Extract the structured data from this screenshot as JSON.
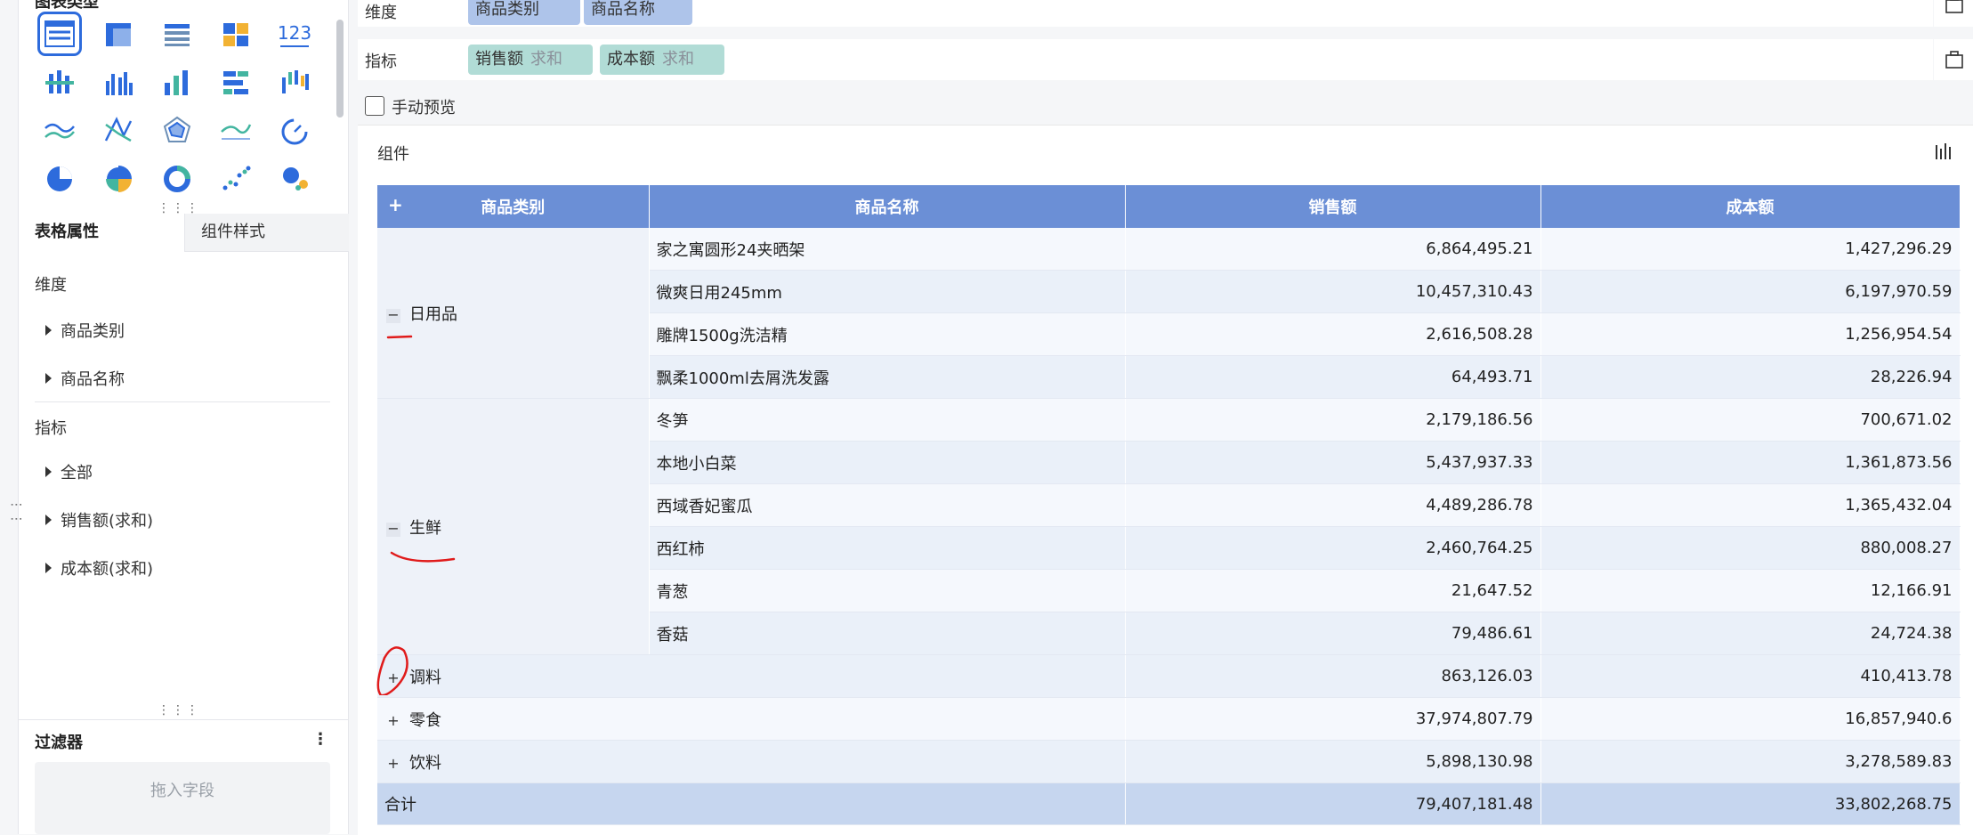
{
  "left_panel": {
    "chart_type_title": "图表类型",
    "chart_icons": [
      "table-icon",
      "cross-table-icon",
      "detail-table-icon",
      "block-table-icon",
      "kpi-number-icon",
      "stacked-bar-icon",
      "grouped-column-icon",
      "column-chart-icon",
      "horizontal-bar-icon",
      "range-column-icon",
      "line-chart-icon",
      "radar-line-icon",
      "radar-chart-icon",
      "area-line-icon",
      "gauge-icon",
      "pie-chart-icon",
      "rose-pie-icon",
      "donut-chart-icon",
      "scatter-plot-icon",
      "bubble-chart-icon"
    ],
    "tabs": {
      "table_props": "表格属性",
      "component_style": "组件样式"
    },
    "dimension_label": "维度",
    "dimension_items": [
      "商品类别",
      "商品名称"
    ],
    "metric_label": "指标",
    "metric_items": [
      "全部",
      "销售额(求和)",
      "成本额(求和)"
    ],
    "filter_title": "过滤器",
    "filter_placeholder": "拖入字段"
  },
  "main": {
    "dimension_row": {
      "label": "维度",
      "fields": [
        "商品类别",
        "商品名称"
      ]
    },
    "metric_row": {
      "label": "指标",
      "fields": [
        {
          "name": "销售额",
          "agg": "求和"
        },
        {
          "name": "成本额",
          "agg": "求和"
        }
      ]
    },
    "manual_preview": "手动预览",
    "component_title": "组件"
  },
  "table": {
    "headers": [
      "商品类别",
      "商品名称",
      "销售额",
      "成本额"
    ],
    "groups": [
      {
        "category": "日用品",
        "expanded": true,
        "rows": [
          {
            "name": "家之寓圆形24夹晒架",
            "sales": "6,864,495.21",
            "cost": "1,427,296.29"
          },
          {
            "name": "微爽日用245mm",
            "sales": "10,457,310.43",
            "cost": "6,197,970.59"
          },
          {
            "name": "雕牌1500g洗洁精",
            "sales": "2,616,508.28",
            "cost": "1,256,954.54"
          },
          {
            "name": "飘柔1000ml去屑洗发露",
            "sales": "64,493.71",
            "cost": "28,226.94"
          }
        ]
      },
      {
        "category": "生鲜",
        "expanded": true,
        "rows": [
          {
            "name": "冬笋",
            "sales": "2,179,186.56",
            "cost": "700,671.02"
          },
          {
            "name": "本地小白菜",
            "sales": "5,437,937.33",
            "cost": "1,361,873.56"
          },
          {
            "name": "西域香妃蜜瓜",
            "sales": "4,489,286.78",
            "cost": "1,365,432.04"
          },
          {
            "name": "西红柿",
            "sales": "2,460,764.25",
            "cost": "880,008.27"
          },
          {
            "name": "青葱",
            "sales": "21,647.52",
            "cost": "12,166.91"
          },
          {
            "name": "香菇",
            "sales": "79,486.61",
            "cost": "24,724.38"
          }
        ]
      },
      {
        "category": "调料",
        "expanded": false,
        "sales": "863,126.03",
        "cost": "410,413.78"
      },
      {
        "category": "零食",
        "expanded": false,
        "sales": "37,974,807.79",
        "cost": "16,857,940.6"
      },
      {
        "category": "饮料",
        "expanded": false,
        "sales": "5,898,130.98",
        "cost": "3,278,589.83"
      }
    ],
    "total": {
      "label": "合计",
      "sales": "79,407,181.48",
      "cost": "33,802,268.75"
    }
  }
}
